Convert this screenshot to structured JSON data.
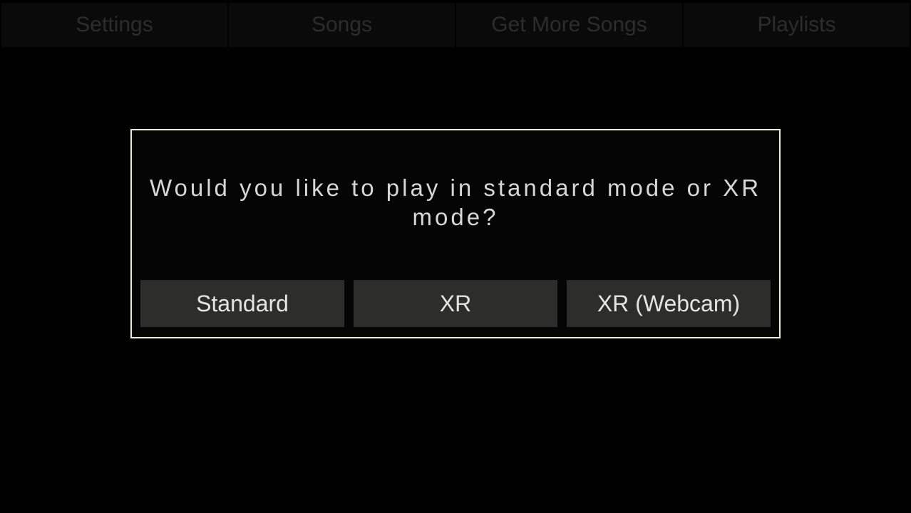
{
  "tabs": {
    "settings": {
      "label": "Settings"
    },
    "songs": {
      "label": "Songs"
    },
    "get_more_songs": {
      "label": "Get More Songs"
    },
    "playlists": {
      "label": "Playlists"
    }
  },
  "modal": {
    "title": "Would you like to play in standard mode or XR mode?",
    "buttons": {
      "standard": {
        "label": "Standard"
      },
      "xr": {
        "label": "XR"
      },
      "xr_webcam": {
        "label": "XR (Webcam)"
      }
    }
  },
  "colors": {
    "modal_border": "#efeedb",
    "button_bg": "#2d2e2b",
    "tab_bg": "#2d2d2d"
  }
}
